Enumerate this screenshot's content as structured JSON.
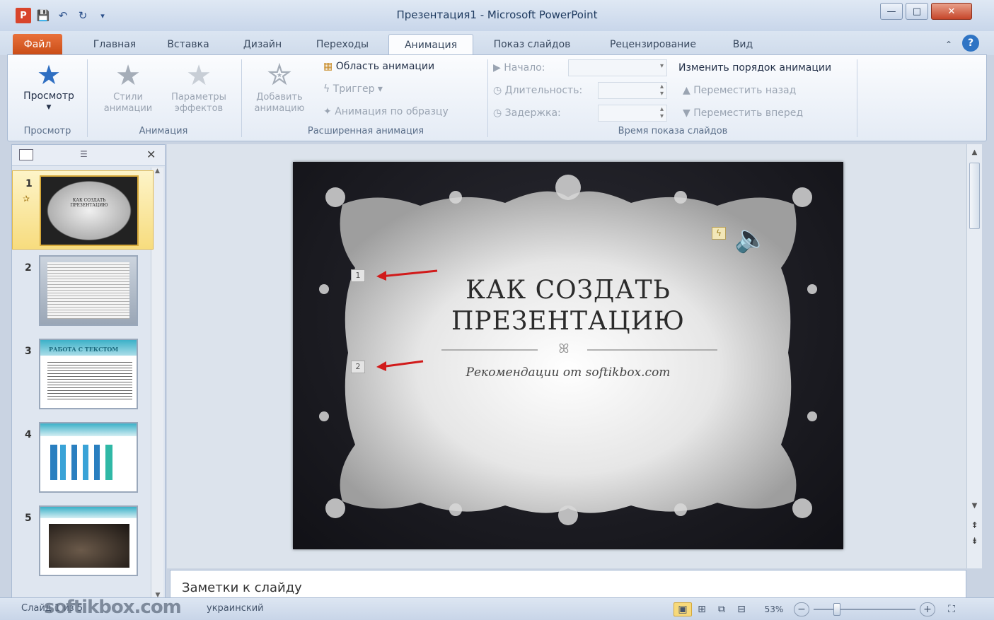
{
  "window": {
    "title": "Презентация1 - Microsoft PowerPoint",
    "minimize": "—",
    "maximize": "□",
    "close": "✕"
  },
  "qat": {
    "app_icon": "P",
    "save_icon": "save-icon",
    "undo_icon": "undo-icon",
    "redo_icon": "redo-icon"
  },
  "tabs": [
    "Файл",
    "Главная",
    "Вставка",
    "Дизайн",
    "Переходы",
    "Анимация",
    "Показ слайдов",
    "Рецензирование",
    "Вид"
  ],
  "ribbon": {
    "preview": {
      "label": "Просмотр",
      "group": "Просмотр"
    },
    "animation": {
      "styles": "Стили\nанимации",
      "effects": "Параметры\nэффектов",
      "group": "Анимация"
    },
    "advanced": {
      "add": "Добавить\nанимацию",
      "pane": "Область анимации",
      "trigger": "Триггер",
      "painter": "Анимация по образцу",
      "group": "Расширенная анимация"
    },
    "timing": {
      "start": "Начало:",
      "duration": "Длительность:",
      "delay": "Задержка:",
      "reorder": "Изменить порядок анимации",
      "move_back": "Переместить назад",
      "move_forward": "Переместить вперед",
      "group": "Время показа слайдов"
    }
  },
  "thumbnails": [
    {
      "num": "1",
      "title": "КАК СОЗДАТЬ ПРЕЗЕНТАЦИЮ"
    },
    {
      "num": "2"
    },
    {
      "num": "3",
      "title": "РАБОТА С ТЕКСТОМ"
    },
    {
      "num": "4"
    },
    {
      "num": "5"
    }
  ],
  "slide": {
    "title_line1": "КАК СОЗДАТЬ",
    "title_line2": "ПРЕЗЕНТАЦИЮ",
    "subtitle": "Рекомендации от softikbox.com",
    "marker1": "1",
    "marker2": "2",
    "flourish": "ꕤ"
  },
  "notes": {
    "placeholder": "Заметки к слайду"
  },
  "status": {
    "slide": "Слайд 1 из 5",
    "language": "украинский",
    "zoom": "53%",
    "watermark": "softikbox.com"
  }
}
